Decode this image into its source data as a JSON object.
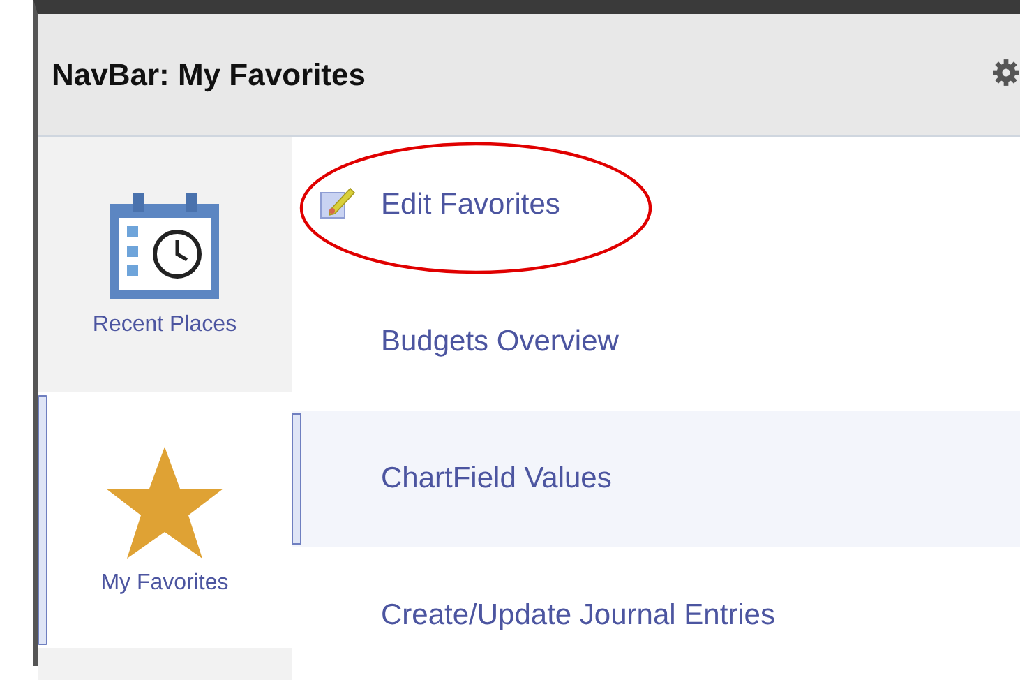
{
  "window": {
    "title": "NavBar: My Favorites"
  },
  "sidebar": {
    "items": [
      {
        "label": "Recent Places",
        "kind": "calendar",
        "selected": false
      },
      {
        "label": "My Favorites",
        "kind": "star",
        "selected": true
      }
    ]
  },
  "menu": {
    "items": [
      {
        "label": "Edit Favorites",
        "kind": "edit",
        "selected": false,
        "circled": true
      },
      {
        "label": "Budgets Overview",
        "kind": "link",
        "selected": false,
        "circled": false
      },
      {
        "label": "ChartField Values",
        "kind": "link",
        "selected": true,
        "circled": false
      },
      {
        "label": "Create/Update Journal Entries",
        "kind": "link",
        "selected": false,
        "circled": false
      }
    ]
  }
}
